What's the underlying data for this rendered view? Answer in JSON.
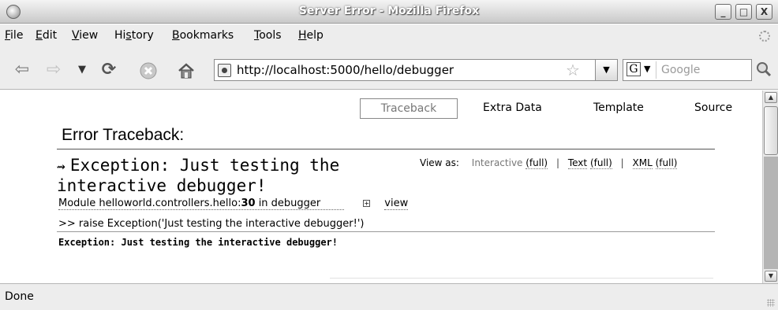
{
  "window": {
    "title": "Server Error - Mozilla Firefox",
    "minimize_label": "_",
    "maximize_label": "□",
    "close_label": "X"
  },
  "menubar": {
    "items": [
      {
        "label": "File",
        "mnemonic": "F"
      },
      {
        "label": "Edit",
        "mnemonic": "E"
      },
      {
        "label": "View",
        "mnemonic": "V"
      },
      {
        "label": "History",
        "mnemonic": "s"
      },
      {
        "label": "Bookmarks",
        "mnemonic": "B"
      },
      {
        "label": "Tools",
        "mnemonic": "T"
      },
      {
        "label": "Help",
        "mnemonic": "H"
      }
    ]
  },
  "navbar": {
    "url": "http://localhost:5000/hello/debugger",
    "search_placeholder": "Google",
    "search_engine_letter": "G",
    "icons": [
      "back-icon",
      "forward-icon",
      "history-dropdown-icon",
      "reload-icon",
      "stop-icon",
      "home-icon",
      "site-identity-icon",
      "bookmark-star-icon",
      "magnifier-icon"
    ]
  },
  "page": {
    "tabs": [
      {
        "label": "Traceback",
        "active": true
      },
      {
        "label": "Extra Data",
        "active": false
      },
      {
        "label": "Template",
        "active": false
      },
      {
        "label": "Source",
        "active": false
      }
    ],
    "heading": "Error Traceback:",
    "exception_title": "Exception: Just testing the interactive debugger!",
    "view_as": {
      "label": "View as:",
      "interactive": "Interactive",
      "interactive_full": "(full)",
      "text": "Text",
      "text_full": "(full)",
      "xml": "XML",
      "xml_full": "(full)",
      "separator": "|"
    },
    "module_line": {
      "prefix": "Module helloworld.controllers.hello:",
      "line_number": "30",
      "suffix": " in debugger",
      "view_label": "view"
    },
    "source_line": ">> raise Exception('Just testing the interactive debugger!')",
    "exception_summary": "Exception: Just testing the interactive debugger!"
  },
  "statusbar": {
    "text": "Done"
  }
}
